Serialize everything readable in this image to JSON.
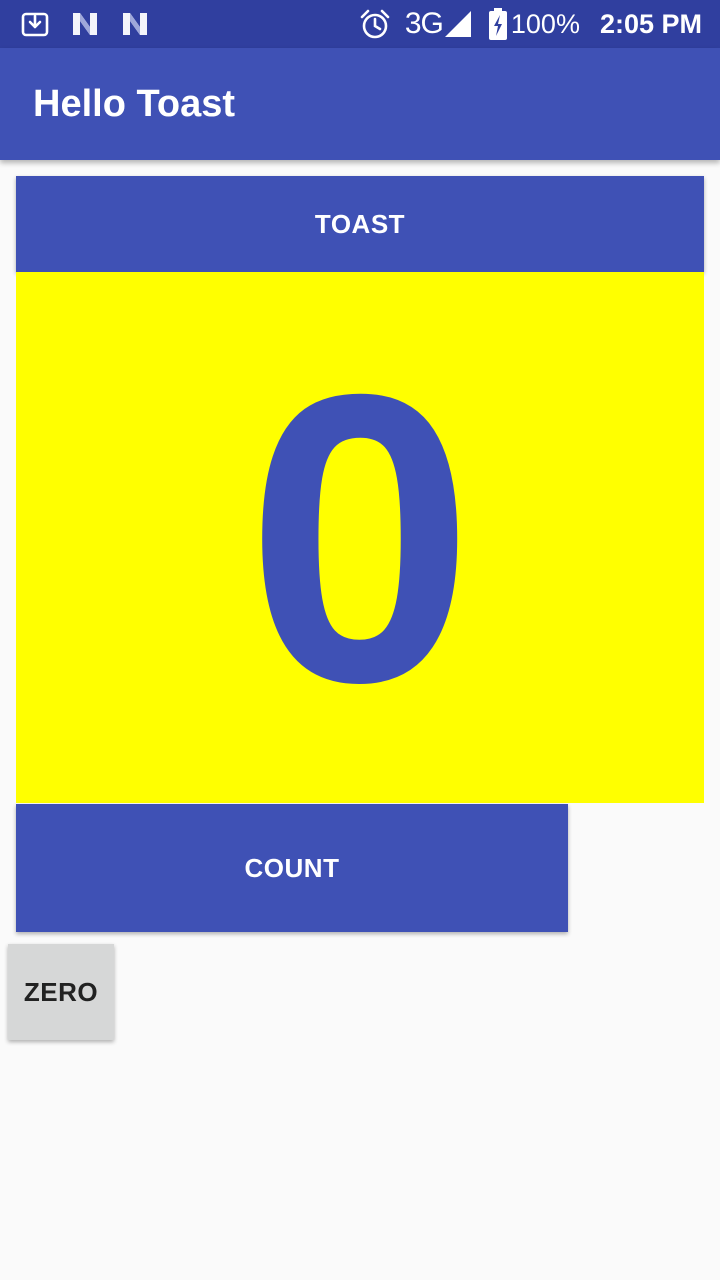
{
  "status_bar": {
    "left_icons": [
      "download-icon",
      "n-notification-icon",
      "n-notification-icon"
    ],
    "right_icons": [
      "alarm-icon",
      "signal-icon",
      "battery-charging-icon"
    ],
    "network": "3G",
    "battery": "100%",
    "time": "2:05 PM",
    "background": "#303f9f"
  },
  "app_bar": {
    "title": "Hello Toast",
    "background": "#3f51b5"
  },
  "main": {
    "toast_label": "TOAST",
    "count_value": "0",
    "count_label": "COUNT",
    "zero_label": "ZERO"
  },
  "colors": {
    "primary": "#3f51b5",
    "primary_dark": "#303f9f",
    "count_panel": "#ffff00",
    "zero_button": "#d6d7d7",
    "background": "#fafafa"
  }
}
